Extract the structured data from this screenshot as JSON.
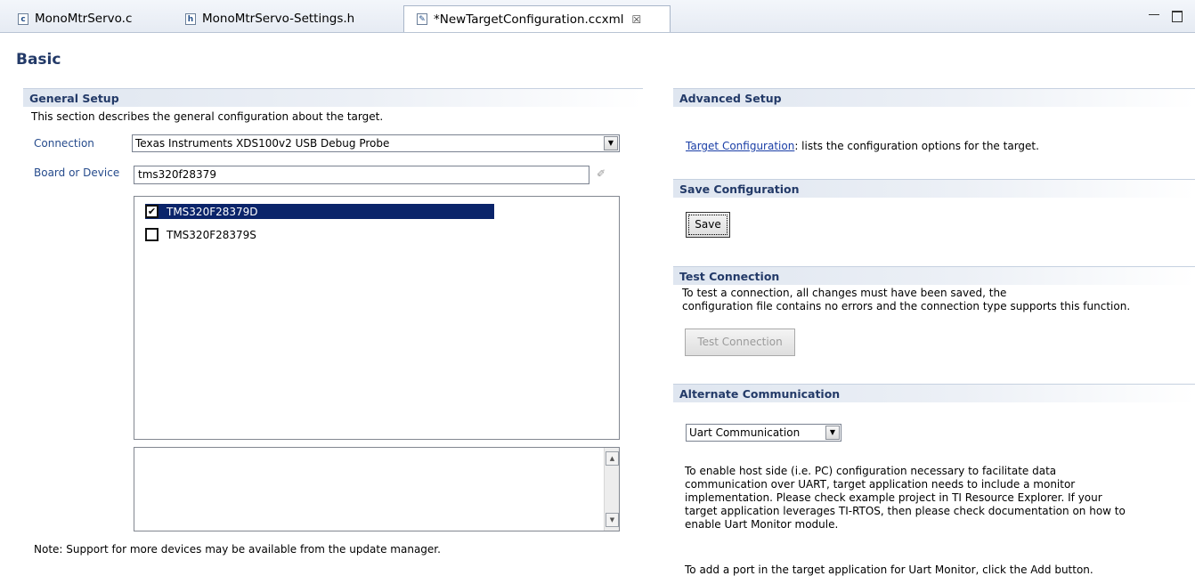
{
  "tabs": [
    {
      "icon": "c-file-icon",
      "icon_text": "c",
      "label": "MonoMtrServo.c"
    },
    {
      "icon": "h-file-icon",
      "icon_text": "h",
      "label": "MonoMtrServo-Settings.h"
    },
    {
      "icon": "ccxml-file-icon",
      "icon_text": "✎",
      "label": "*NewTargetConfiguration.ccxml",
      "close": "☒"
    }
  ],
  "page_title": "Basic",
  "general_setup": {
    "title": "General Setup",
    "description": "This section describes the general configuration about the target.",
    "connection_label": "Connection",
    "connection_value": "Texas Instruments XDS100v2 USB Debug Probe",
    "board_label": "Board or Device",
    "board_value": "tms320f28379",
    "devices": [
      {
        "label": "TMS320F28379D",
        "checked": true,
        "mark": "✔"
      },
      {
        "label": "TMS320F28379S",
        "checked": false,
        "mark": ""
      }
    ],
    "note": "Note: Support for more devices may be available from the update manager."
  },
  "advanced_setup": {
    "title": "Advanced Setup",
    "link": "Target Configuration",
    "link_suffix": ": lists the configuration options for the target."
  },
  "save_configuration": {
    "title": "Save Configuration",
    "save_label": "Save"
  },
  "test_connection": {
    "title": "Test Connection",
    "line1": "To test a connection, all changes must have been saved, the",
    "line2": "configuration file contains no errors and the connection type supports this function.",
    "button_label": "Test Connection"
  },
  "alternate_communication": {
    "title": "Alternate Communication",
    "select_value": "Uart Communication",
    "desc_lines": [
      "To enable host side (i.e. PC) configuration necessary to facilitate data",
      "communication over UART, target application needs to include a monitor",
      "implementation. Please check example project in TI Resource Explorer. If your",
      "target application leverages TI-RTOS, then please check documentation on how to",
      "enable Uart Monitor module."
    ],
    "add_port_text": "To add a port in the target application for Uart Monitor, click the Add button."
  },
  "colors": {
    "heading": "#233a68",
    "label": "#264b8c",
    "selection": "#0a246a",
    "link": "#1a3ea6"
  }
}
